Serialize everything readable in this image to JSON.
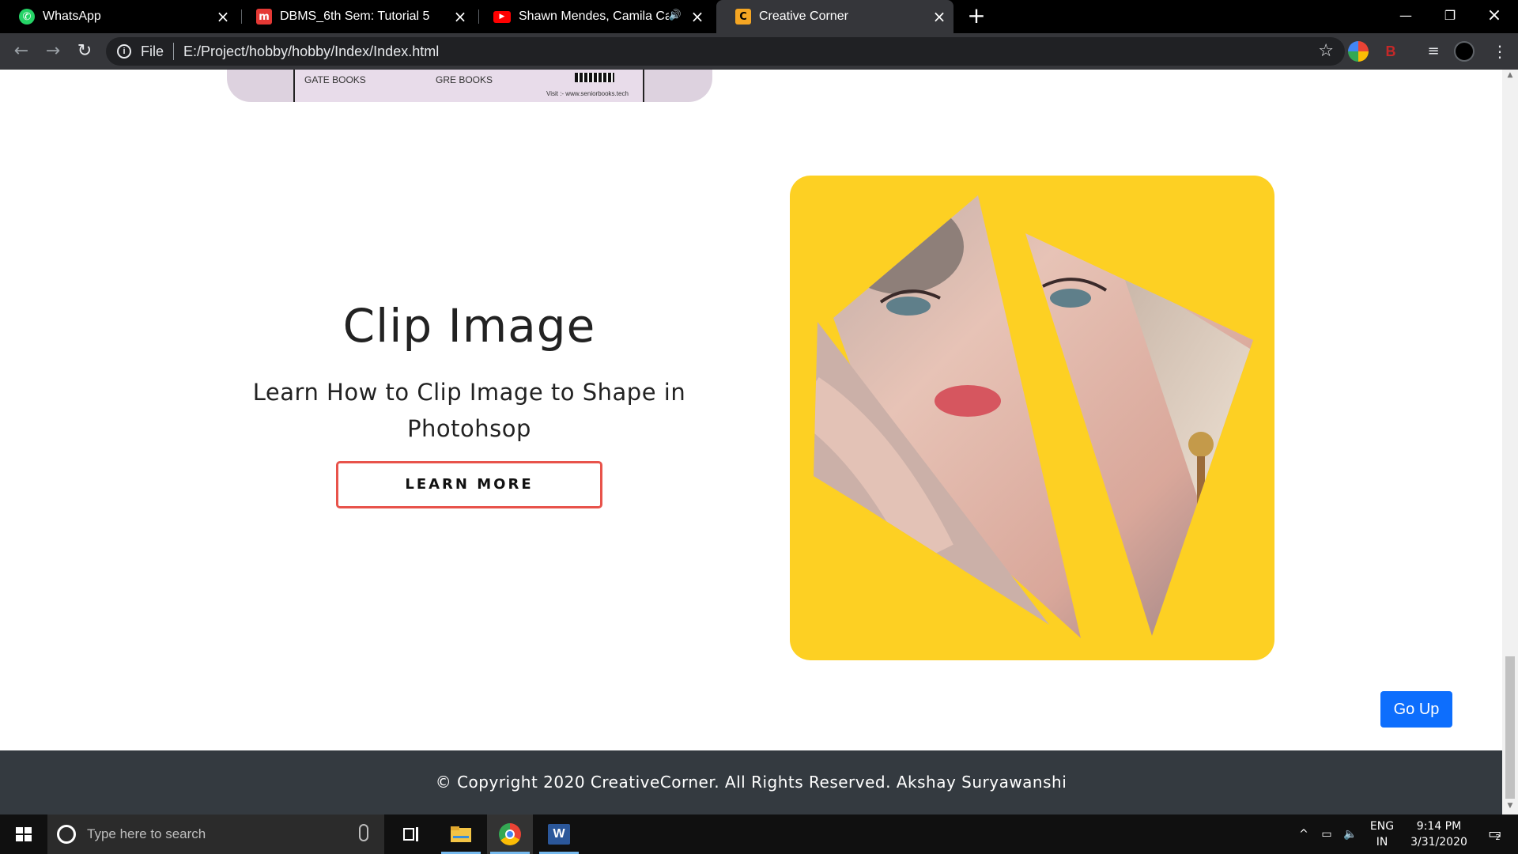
{
  "browser": {
    "tabs": [
      {
        "title": "WhatsApp",
        "icon": "whatsapp-icon",
        "color": "#25d366"
      },
      {
        "title": "DBMS_6th Sem: Tutorial 5",
        "icon": "m-logo-icon",
        "color": "#e53935"
      },
      {
        "title": "Shawn Mendes, Camila Cabe",
        "icon": "youtube-icon",
        "color": "#ff0000",
        "audio": true
      },
      {
        "title": "Creative Corner",
        "icon": "c-logo-icon",
        "color": "#f5a623",
        "active": true
      }
    ],
    "address": {
      "scheme_label": "File",
      "url": "E:/Project/hobby/hobby/Index/Index.html"
    }
  },
  "page": {
    "banner": {
      "left_label": "GATE BOOKS",
      "right_label": "GRE BOOKS",
      "visit_text": "Visit :- www.seniorbooks.tech"
    },
    "hero": {
      "title": "Clip Image",
      "subtitle": "Learn How to Clip Image to Shape in Photohsop",
      "button_label": "LEARN MORE"
    },
    "clip_card": {
      "background_color": "#fdd023"
    },
    "go_up_label": "Go Up",
    "footer_text": "© Copyright 2020 CreativeCorner. All Rights Reserved. Akshay Suryawanshi"
  },
  "taskbar": {
    "search_placeholder": "Type here to search",
    "pinned": [
      "task-view-icon",
      "file-explorer-icon",
      "chrome-icon",
      "word-icon"
    ],
    "language_top": "ENG",
    "language_bottom": "IN",
    "time": "9:14 PM",
    "date": "3/31/2020",
    "notification_count": "2"
  }
}
